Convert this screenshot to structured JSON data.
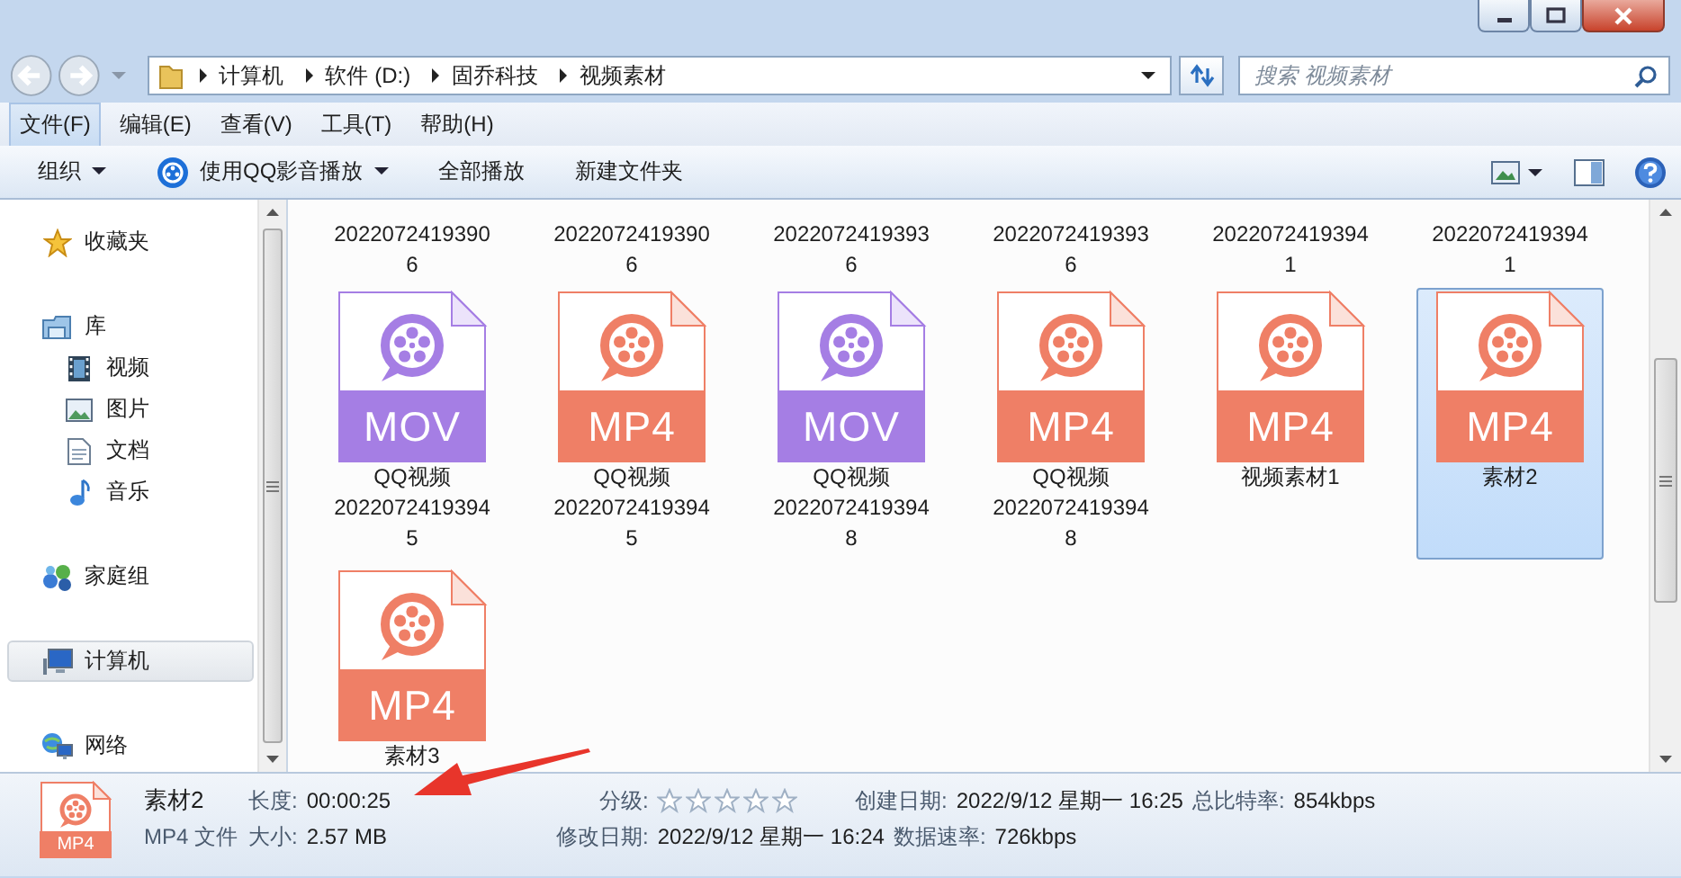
{
  "address": {
    "crumbs": [
      "计算机",
      "软件 (D:)",
      "固乔科技",
      "视频素材"
    ]
  },
  "search": {
    "placeholder": "搜索 视频素材"
  },
  "menu": [
    {
      "label": "文件(F)",
      "selected": true
    },
    {
      "label": "编辑(E)",
      "selected": false
    },
    {
      "label": "查看(V)",
      "selected": false
    },
    {
      "label": "工具(T)",
      "selected": false
    },
    {
      "label": "帮助(H)",
      "selected": false
    }
  ],
  "toolbar": [
    {
      "label": "组织",
      "kind": "plain",
      "dropdown": true
    },
    {
      "label": "使用QQ影音播放",
      "kind": "player",
      "dropdown": true
    },
    {
      "label": "全部播放",
      "kind": "plain",
      "dropdown": false
    },
    {
      "label": "新建文件夹",
      "kind": "plain",
      "dropdown": false
    }
  ],
  "sidebar": [
    {
      "label": "收藏夹",
      "kind": "favorites",
      "selected": false
    },
    {
      "label": "库",
      "kind": "library",
      "selected": false,
      "children": [
        {
          "label": "视频",
          "kind": "video",
          "selected": false
        },
        {
          "label": "图片",
          "kind": "pictures",
          "selected": false
        },
        {
          "label": "文档",
          "kind": "documents",
          "selected": false
        },
        {
          "label": "音乐",
          "kind": "music",
          "selected": false
        }
      ]
    },
    {
      "label": "家庭组",
      "kind": "homegroup",
      "selected": false
    },
    {
      "label": "计算机",
      "kind": "computer",
      "selected": true
    },
    {
      "label": "网络",
      "kind": "network",
      "selected": false
    }
  ],
  "scrolled_row": [
    {
      "lines": [
        "2022072419390",
        "6"
      ]
    },
    {
      "lines": [
        "2022072419390",
        "6"
      ]
    },
    {
      "lines": [
        "2022072419393",
        "6"
      ]
    },
    {
      "lines": [
        "2022072419393",
        "6"
      ]
    },
    {
      "lines": [
        "2022072419394",
        "1"
      ]
    },
    {
      "lines": [
        "2022072419394",
        "1"
      ]
    }
  ],
  "files": [
    {
      "kind": "mov",
      "badge": "MOV",
      "lines": [
        "QQ视频",
        "2022072419394",
        "5"
      ],
      "selected": false
    },
    {
      "kind": "mp4",
      "badge": "MP4",
      "lines": [
        "QQ视频",
        "2022072419394",
        "5"
      ],
      "selected": false
    },
    {
      "kind": "mov",
      "badge": "MOV",
      "lines": [
        "QQ视频",
        "2022072419394",
        "8"
      ],
      "selected": false
    },
    {
      "kind": "mp4",
      "badge": "MP4",
      "lines": [
        "QQ视频",
        "2022072419394",
        "8"
      ],
      "selected": false
    },
    {
      "kind": "mp4",
      "badge": "MP4",
      "lines": [
        "视频素材1"
      ],
      "selected": false
    },
    {
      "kind": "mp4",
      "badge": "MP4",
      "lines": [
        "素材2"
      ],
      "selected": true
    },
    {
      "kind": "mp4",
      "badge": "MP4",
      "lines": [
        "素材3"
      ],
      "selected": false
    }
  ],
  "details": {
    "badge": "MP4",
    "name": "素材2",
    "type": "MP4 文件",
    "length": {
      "label": "长度:",
      "value": "00:00:25"
    },
    "size": {
      "label": "大小:",
      "value": "2.57 MB"
    },
    "rating": {
      "label": "分级:",
      "stars": 0
    },
    "created": {
      "label": "创建日期:",
      "value": "2022/9/12 星期一 16:25"
    },
    "total_bitrate": {
      "label": "总比特率:",
      "value": "854kbps"
    },
    "modified": {
      "label": "修改日期:",
      "value": "2022/9/12 星期一 16:24"
    },
    "data_rate": {
      "label": "数据速率:",
      "value": "726kbps"
    }
  }
}
